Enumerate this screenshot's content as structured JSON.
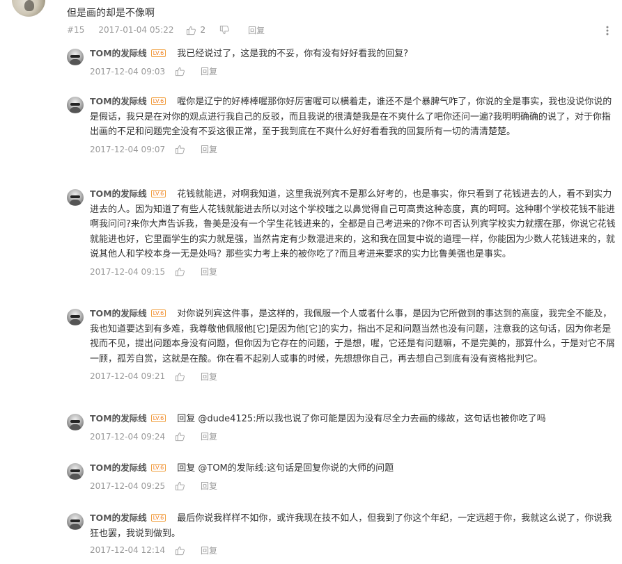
{
  "main_comment": {
    "text": "但是画的却是不像啊",
    "floor": "#15",
    "time": "2017-01-04 05:22",
    "likes": "2",
    "reply_label": "回复"
  },
  "replies": [
    {
      "user": "TOM的发际线",
      "level": "LV.6",
      "text": "我已经说过了，这是我的不妥，你有没有好好看我的回复?",
      "time": "2017-12-04 09:03",
      "reply_label": "回复"
    },
    {
      "user": "TOM的发际线",
      "level": "LV.6",
      "text": "喔你是辽宁的好棒棒喔那你好厉害喔可以横着走，谁还不是个暴脾气咋了，你说的全是事实，我也没说你说的是假话，我只是在对你的观点进行我自己的反驳，而且我说的很清楚我是在不爽什么了吧你还问一遍?我明明确确的说了，对于你指出画的不足和问题完全没有不妥这很正常，至于我到底在不爽什么好好看看我的回复所有一切的清清楚楚。",
      "time": "2017-12-04 09:07",
      "reply_label": "回复"
    },
    {
      "user": "TOM的发际线",
      "level": "LV.6",
      "text": "花钱就能进，对啊我知道，这里我说列宾不是那么好考的，也是事实，你只看到了花钱进去的人，看不到实力进去的人。因为知道了有些人花钱就能进去所以对这个学校嗤之以鼻觉得自己可高贵这种态度，真的呵呵。这种哪个学校花钱不能进啊我问问?来你大声告诉我，鲁美是没有一个学生花钱进来的，全都是自己考进来的?你不可否认列宾学校实力就摆在那，你说它花钱就能进也好，它里面学生的实力就是强，当然肯定有少数混进来的，这和我在回复中说的道理一样，你能因为少数人花钱进来的，就说其他人和学校本身一无是处吗？那些实力考上来的被你吃了?而且考进来要求的实力比鲁美强也是事实。",
      "time": "2017-12-04 09:15",
      "reply_label": "回复"
    },
    {
      "user": "TOM的发际线",
      "level": "LV.6",
      "text": "对你说列宾这件事，是这样的，我佩服一个人或者什么事，是因为它所做到的事达到的高度，我完全不能及，我也知道要达到有多难，我尊敬他佩服他[它]是因为他[它]的实力，指出不足和问题当然也没有问题，注意我的这句话，因为你老是视而不见，提出问题本身没有问题，但你因为它存在的问题，于是想，喔，它还是有问题嘛，不是完美的，那算什么，于是对它不屑一顾，孤芳自赏，这就是在酸。你在看不起别人或事的时候，先想想你自己，再去想自己到底有没有资格批判它。",
      "time": "2017-12-04 09:21",
      "reply_label": "回复"
    },
    {
      "user": "TOM的发际线",
      "level": "LV.6",
      "text": "回复 @dude4125:所以我也说了你可能是因为没有尽全力去画的缘故，这句话也被你吃了吗",
      "time": "2017-12-04 09:24",
      "reply_label": "回复"
    },
    {
      "user": "TOM的发际线",
      "level": "LV.6",
      "text": "回复 @TOM的发际线:这句话是回复你说的大师的问题",
      "time": "2017-12-04 09:25",
      "reply_label": "回复"
    },
    {
      "user": "TOM的发际线",
      "level": "LV.6",
      "text": "最后你说我样样不如你，或许我现在技不如人，但我到了你这个年纪，一定远超于你，我就这么说了，你说我狂也罢，我说到做到。",
      "time": "2017-12-04 12:14",
      "reply_label": "回复"
    }
  ]
}
